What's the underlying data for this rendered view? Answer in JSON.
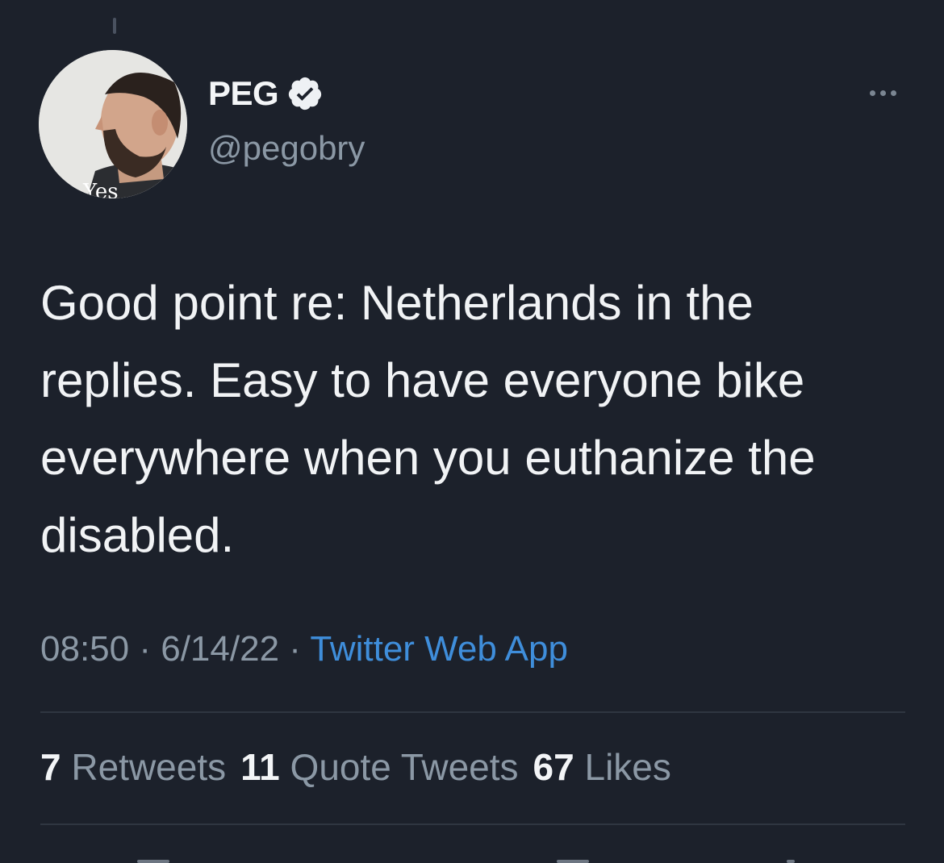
{
  "tweet": {
    "author": {
      "display_name": "PEG",
      "handle": "@pegobry",
      "verified_icon": "verified-badge-icon",
      "avatar_caption": "Yes"
    },
    "text": "Good point re: Netherlands in the replies. Easy to have everyone bike everywhere when you euthanize the disabled.",
    "time": "08:50",
    "separator": "·",
    "date": "6/14/22",
    "source": "Twitter Web App",
    "stats": {
      "retweets_count": "7",
      "retweets_label": "Retweets",
      "quote_tweets_count": "11",
      "quote_tweets_label": "Quote Tweets",
      "likes_count": "67",
      "likes_label": "Likes"
    }
  },
  "colors": {
    "background": "#1c212b",
    "text_primary": "#f1f3f5",
    "text_secondary": "#8b98a5",
    "link": "#3f8edb"
  }
}
